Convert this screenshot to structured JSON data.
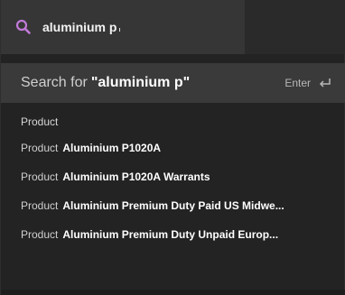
{
  "search": {
    "value": "aluminium p",
    "icon": "search-icon",
    "icon_color": "#c07ad8"
  },
  "search_for": {
    "prefix": "Search for",
    "query": "\"aluminium p\"",
    "enter_label": "Enter",
    "enter_icon": "enter-return-icon"
  },
  "section": {
    "header": "Product"
  },
  "results": [
    {
      "type": "Product",
      "name": "Aluminium P1020A"
    },
    {
      "type": "Product",
      "name": "Aluminium P1020A Warrants"
    },
    {
      "type": "Product",
      "name": "Aluminium Premium Duty Paid US Midwe..."
    },
    {
      "type": "Product",
      "name": "Aluminium Premium Duty Unpaid Europ..."
    }
  ]
}
